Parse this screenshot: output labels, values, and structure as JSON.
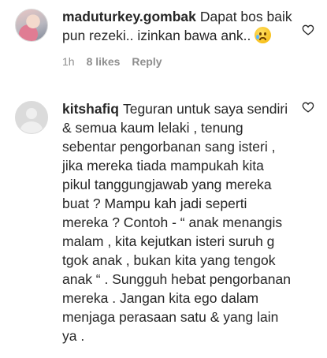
{
  "comments": [
    {
      "username": "maduturkey.gombak",
      "text": "Dapat bos baik pun rezeki.. izinkan bawa ank..",
      "emoji": "crying-face-emoji",
      "time": "1h",
      "likes": "8 likes",
      "reply": "Reply",
      "avatar": "profile-photo"
    },
    {
      "username": "kitshafiq",
      "text": "Teguran untuk saya sendiri & semua kaum lelaki , tenung sebentar pengorbanan sang isteri , jika mereka tiada mampukah kita pikul tanggungjawab yang mereka buat ? Mampu kah jadi seperti mereka ? Contoh - “ anak menangis malam , kita kejutkan isteri suruh g tgok anak , bukan kita yang tengok anak “ . Sungguh hebat pengorbanan mereka . Jangan kita ego dalam menjaga perasaan satu & yang lain ya .",
      "avatar": "default-avatar"
    }
  ],
  "icons": {
    "like": "heart-outline-icon"
  },
  "colors": {
    "text": "#262626",
    "muted": "#8e8e8e",
    "divider": "#dbdbdb"
  }
}
